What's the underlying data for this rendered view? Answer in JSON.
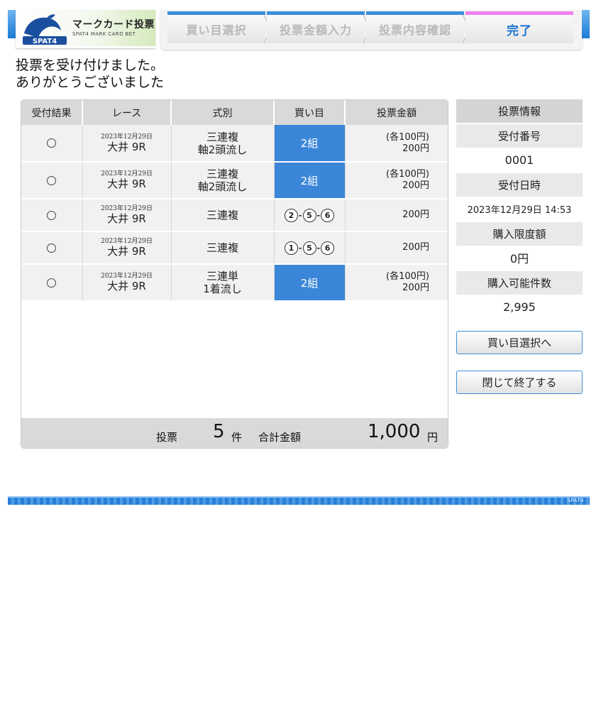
{
  "header": {
    "logo_title": "マークカード投票",
    "logo_subtitle": "SPAT4 MARK CARD BET",
    "logo_brand": "SPAT4",
    "steps": [
      {
        "label": "買い目選択"
      },
      {
        "label": "投票金額入力"
      },
      {
        "label": "投票内容確認"
      },
      {
        "label": "完了"
      }
    ],
    "active_step_color": "#1c74cf",
    "accent_color": "#3a8fde",
    "current_step_marker": "#f07ef0"
  },
  "message": {
    "line1": "投票を受け付けました。",
    "line2": "ありがとうございました"
  },
  "table": {
    "columns": [
      "受付結果",
      "レース",
      "式別",
      "買い目",
      "投票金額"
    ],
    "rows": [
      {
        "result": "○",
        "date": "2023年12月29日",
        "track": "大井 9R",
        "kind1": "三連複",
        "kind2": "軸2頭流し",
        "pick": "2組",
        "each": "(各100円)",
        "amount": "200円"
      },
      {
        "result": "○",
        "date": "2023年12月29日",
        "track": "大井 9R",
        "kind1": "三連複",
        "kind2": "軸2頭流し",
        "pick": "2組",
        "each": "(各100円)",
        "amount": "200円"
      },
      {
        "result": "○",
        "date": "2023年12月29日",
        "track": "大井 9R",
        "kind1": "三連複",
        "kind2": "",
        "pick_numbers": [
          "2",
          "5",
          "6"
        ],
        "each": "",
        "amount": "200円"
      },
      {
        "result": "○",
        "date": "2023年12月29日",
        "track": "大井 9R",
        "kind1": "三連複",
        "kind2": "",
        "pick_numbers": [
          "1",
          "5",
          "6"
        ],
        "each": "",
        "amount": "200円"
      },
      {
        "result": "○",
        "date": "2023年12月29日",
        "track": "大井 9R",
        "kind1": "三連単",
        "kind2": "1着流し",
        "pick": "2組",
        "each": "(各100円)",
        "amount": "200円"
      }
    ],
    "footer": {
      "label_votes": "投票",
      "count": "5",
      "count_unit": "件",
      "label_total": "合計金額",
      "total": "1,000",
      "total_unit": "円"
    },
    "pick_highlight_color": "#3b86d8"
  },
  "side": {
    "title": "投票情報",
    "receipt_label": "受付番号",
    "receipt_value": "0001",
    "datetime_label": "受付日時",
    "datetime_value": "2023年12月29日 14:53",
    "limit_label": "購入限度額",
    "limit_value": "0円",
    "available_label": "購入可能件数",
    "available_value": "2,995",
    "btn_back": "買い目選択へ",
    "btn_close": "閉じて終了する"
  },
  "footer": {
    "brand": "SPAT4"
  }
}
